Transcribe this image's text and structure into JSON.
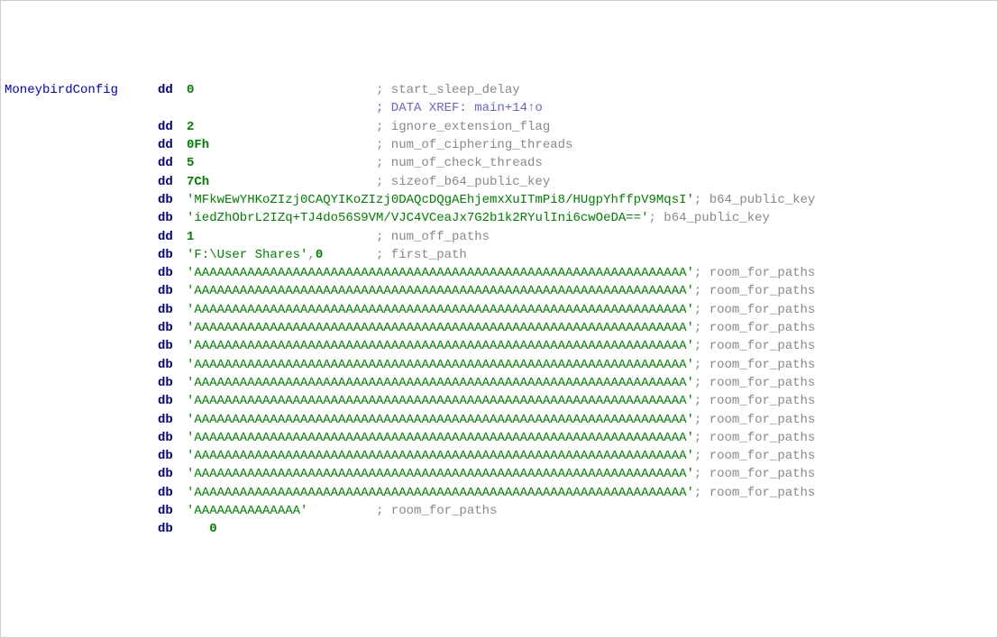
{
  "label": "MoneybirdConfig",
  "lines": [
    {
      "opcode": "dd",
      "value": "0",
      "comment": "; start_sleep_delay",
      "type": "num"
    },
    {
      "opcode": "",
      "value": "",
      "comment": "; DATA XREF: main+14↑o",
      "type": "xref"
    },
    {
      "opcode": "dd",
      "value": "2",
      "comment": "; ignore_extension_flag",
      "type": "num"
    },
    {
      "opcode": "dd",
      "value": "0Fh",
      "comment": "; num_of_ciphering_threads",
      "type": "num"
    },
    {
      "opcode": "dd",
      "value": "5",
      "comment": "; num_of_check_threads",
      "type": "num"
    },
    {
      "opcode": "dd",
      "value": "7Ch",
      "comment": "; sizeof_b64_public_key",
      "type": "num"
    },
    {
      "opcode": "db",
      "value": "'MFkwEwYHKoZIzj0CAQYIKoZIzj0DAQcDQgAEhjemxXuITmPi8/HUgpYhffpV9MqsI'",
      "comment": "; b64_public_key",
      "type": "string-long"
    },
    {
      "opcode": "db",
      "value": "'iedZhObrL2IZq+TJ4do56S9VM/VJC4VCeaJx7G2b1k2RYulIni6cwOeDA=='",
      "comment": "; b64_public_key",
      "type": "string-long"
    },
    {
      "opcode": "dd",
      "value": "1",
      "comment": "; num_off_paths",
      "type": "num"
    },
    {
      "opcode": "db",
      "value": "'F:\\User Shares',0",
      "comment": "; first_path",
      "type": "string-short"
    },
    {
      "opcode": "db",
      "value": "'AAAAAAAAAAAAAAAAAAAAAAAAAAAAAAAAAAAAAAAAAAAAAAAAAAAAAAAAAAAAAAAAA'",
      "comment": "; room_for_paths",
      "type": "string-long"
    },
    {
      "opcode": "db",
      "value": "'AAAAAAAAAAAAAAAAAAAAAAAAAAAAAAAAAAAAAAAAAAAAAAAAAAAAAAAAAAAAAAAAA'",
      "comment": "; room_for_paths",
      "type": "string-long"
    },
    {
      "opcode": "db",
      "value": "'AAAAAAAAAAAAAAAAAAAAAAAAAAAAAAAAAAAAAAAAAAAAAAAAAAAAAAAAAAAAAAAAA'",
      "comment": "; room_for_paths",
      "type": "string-long"
    },
    {
      "opcode": "db",
      "value": "'AAAAAAAAAAAAAAAAAAAAAAAAAAAAAAAAAAAAAAAAAAAAAAAAAAAAAAAAAAAAAAAAA'",
      "comment": "; room_for_paths",
      "type": "string-long"
    },
    {
      "opcode": "db",
      "value": "'AAAAAAAAAAAAAAAAAAAAAAAAAAAAAAAAAAAAAAAAAAAAAAAAAAAAAAAAAAAAAAAAA'",
      "comment": "; room_for_paths",
      "type": "string-long"
    },
    {
      "opcode": "db",
      "value": "'AAAAAAAAAAAAAAAAAAAAAAAAAAAAAAAAAAAAAAAAAAAAAAAAAAAAAAAAAAAAAAAAA'",
      "comment": "; room_for_paths",
      "type": "string-long"
    },
    {
      "opcode": "db",
      "value": "'AAAAAAAAAAAAAAAAAAAAAAAAAAAAAAAAAAAAAAAAAAAAAAAAAAAAAAAAAAAAAAAAA'",
      "comment": "; room_for_paths",
      "type": "string-long"
    },
    {
      "opcode": "db",
      "value": "'AAAAAAAAAAAAAAAAAAAAAAAAAAAAAAAAAAAAAAAAAAAAAAAAAAAAAAAAAAAAAAAAA'",
      "comment": "; room_for_paths",
      "type": "string-long"
    },
    {
      "opcode": "db",
      "value": "'AAAAAAAAAAAAAAAAAAAAAAAAAAAAAAAAAAAAAAAAAAAAAAAAAAAAAAAAAAAAAAAAA'",
      "comment": "; room_for_paths",
      "type": "string-long"
    },
    {
      "opcode": "db",
      "value": "'AAAAAAAAAAAAAAAAAAAAAAAAAAAAAAAAAAAAAAAAAAAAAAAAAAAAAAAAAAAAAAAAA'",
      "comment": "; room_for_paths",
      "type": "string-long"
    },
    {
      "opcode": "db",
      "value": "'AAAAAAAAAAAAAAAAAAAAAAAAAAAAAAAAAAAAAAAAAAAAAAAAAAAAAAAAAAAAAAAAA'",
      "comment": "; room_for_paths",
      "type": "string-long"
    },
    {
      "opcode": "db",
      "value": "'AAAAAAAAAAAAAAAAAAAAAAAAAAAAAAAAAAAAAAAAAAAAAAAAAAAAAAAAAAAAAAAAA'",
      "comment": "; room_for_paths",
      "type": "string-long"
    },
    {
      "opcode": "db",
      "value": "'AAAAAAAAAAAAAAAAAAAAAAAAAAAAAAAAAAAAAAAAAAAAAAAAAAAAAAAAAAAAAAAAA'",
      "comment": "; room_for_paths",
      "type": "string-long"
    },
    {
      "opcode": "db",
      "value": "'AAAAAAAAAAAAAA'",
      "comment": "; room_for_paths",
      "type": "string-short"
    },
    {
      "opcode": "db",
      "value": "   0",
      "comment": "",
      "type": "num"
    }
  ]
}
